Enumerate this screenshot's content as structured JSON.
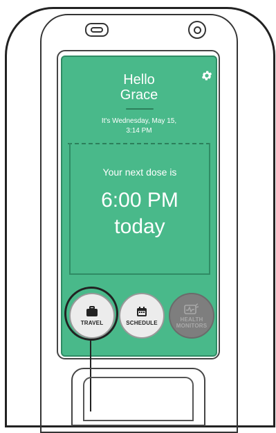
{
  "screen": {
    "greeting_line1": "Hello",
    "greeting_line2": "Grace",
    "date_line1": "It's Wednesday, May 15,",
    "date_line2": "3:14 PM",
    "dose_label": "Your next dose is",
    "dose_time": "6:00 PM",
    "dose_day": "today",
    "settings_icon": "gear-icon"
  },
  "nav": {
    "travel_label": "TRAVEL",
    "travel_icon": "briefcase-icon",
    "schedule_label": "SCHEDULE",
    "schedule_icon": "calendar-icon",
    "health_label_line1": "HEALTH",
    "health_label_line2": "MONITORS",
    "health_icon": "health-monitor-icon"
  },
  "colors": {
    "screen_green": "#49b98a",
    "button_light": "#ececec",
    "button_disabled": "#7e7e7e"
  }
}
